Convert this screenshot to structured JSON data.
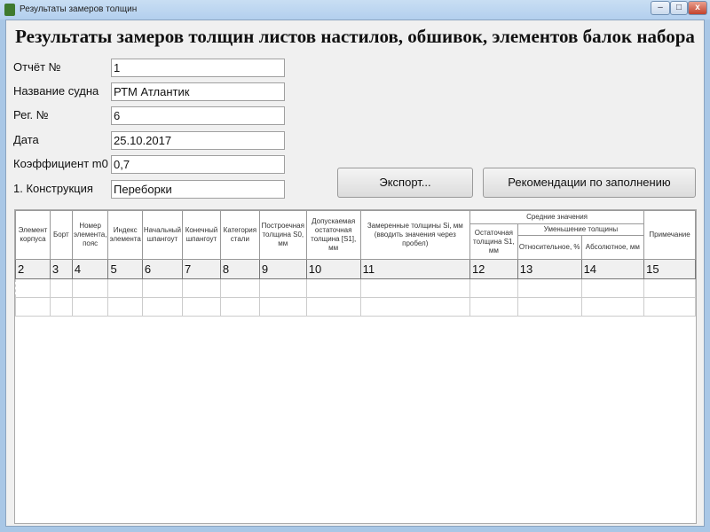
{
  "window": {
    "title": "Результаты замеров толщин",
    "minimize": "–",
    "maximize": "□",
    "close": "x"
  },
  "heading": "Результаты замеров толщин листов настилов, обшивок, элементов балок набора",
  "form": [
    {
      "label": "Отчёт №",
      "value": "1"
    },
    {
      "label": "Название судна",
      "value": "РТМ Атлантик"
    },
    {
      "label": "Рег. №",
      "value": "6"
    },
    {
      "label": "Дата",
      "value": "25.10.2017"
    },
    {
      "label": "Коэффициент m0",
      "value": "0,7"
    },
    {
      "label": "1. Конструкция",
      "value": "Переборки"
    }
  ],
  "buttons": {
    "export": "Экспорт...",
    "recommendations": "Рекомендации по заполнению"
  },
  "table": {
    "headers": [
      "Элемент корпуса",
      "Борт",
      "Номер элемента, пояс",
      "Индекс элемента",
      "Начальный шпангоут",
      "Конечный шпангоут",
      "Категория стали",
      "Построечная толщина S0, мм",
      "Допускаемая остаточная толщина [S1], мм",
      "Замеренные толщины Si, мм (вводить значения через пробел)"
    ],
    "group": "Средние значения",
    "residual": "Остаточная толщина S1, мм",
    "reduction": "Уменьшение толщины",
    "relative": "Относительное, %",
    "absolute": "Абсолютное, мм",
    "note": "Примечание",
    "numbers": [
      "2",
      "3",
      "4",
      "5",
      "6",
      "7",
      "8",
      "9",
      "10",
      "11",
      "12",
      "13",
      "14",
      "15"
    ]
  }
}
